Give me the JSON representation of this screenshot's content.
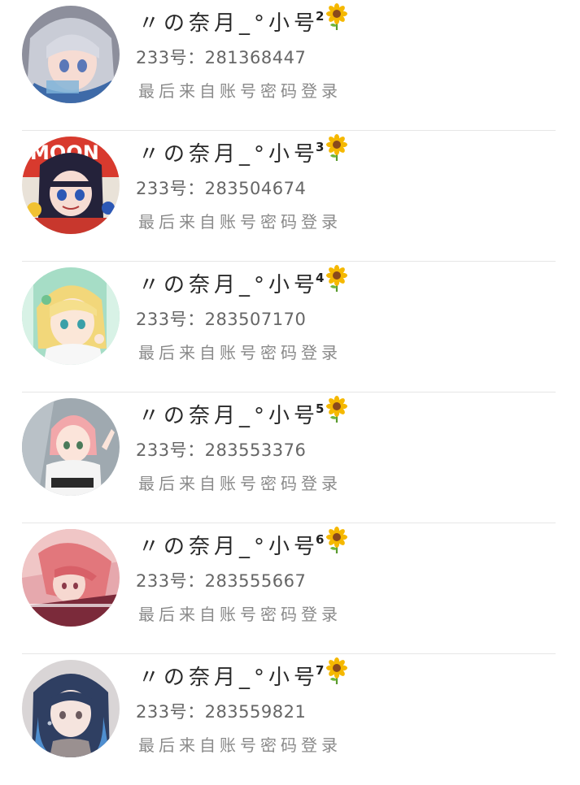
{
  "accounts": [
    {
      "name_prefix": "〃の奈月_°小号",
      "suffix_number": "2",
      "flower_icon": "sunflower-icon",
      "id_line": "233号：281368447",
      "login_info": "最后来自账号密码登录",
      "avatar_colors": {
        "bg": "#8d8f9c",
        "hair": "#c9ccd6",
        "accent": "#5a78b8"
      }
    },
    {
      "name_prefix": "〃の奈月_°小号",
      "suffix_number": "3",
      "flower_icon": "sunflower-icon",
      "id_line": "233号：283504674",
      "login_info": "最后来自账号密码登录",
      "avatar_colors": {
        "bg": "#d83a2e",
        "hair": "#24223a",
        "accent": "#2c58b5"
      }
    },
    {
      "name_prefix": "〃の奈月_°小号",
      "suffix_number": "4",
      "flower_icon": "sunflower-icon",
      "id_line": "233号：283507170",
      "login_info": "最后来自账号密码登录",
      "avatar_colors": {
        "bg": "#a6ddc6",
        "hair": "#f2d77a",
        "accent": "#6fc28f"
      }
    },
    {
      "name_prefix": "〃の奈月_°小号",
      "suffix_number": "5",
      "flower_icon": "sunflower-icon",
      "id_line": "233号：283553376",
      "login_info": "最后来自账号密码登录",
      "avatar_colors": {
        "bg": "#9fa9b0",
        "hair": "#f2a7aa",
        "accent": "#ffffff"
      }
    },
    {
      "name_prefix": "〃の奈月_°小号",
      "suffix_number": "6",
      "flower_icon": "sunflower-icon",
      "id_line": "233号：283555667",
      "login_info": "最后来自账号密码登录",
      "avatar_colors": {
        "bg": "#e6a8ad",
        "hair": "#e2777c",
        "accent": "#7b2a3a"
      }
    },
    {
      "name_prefix": "〃の奈月_°小号",
      "suffix_number": "7",
      "flower_icon": "sunflower-icon",
      "id_line": "233号：283559821",
      "login_info": "最后来自账号密码登录",
      "avatar_colors": {
        "bg": "#d9d5d6",
        "hair": "#2f3f62",
        "accent": "#4f8fd0"
      }
    }
  ]
}
